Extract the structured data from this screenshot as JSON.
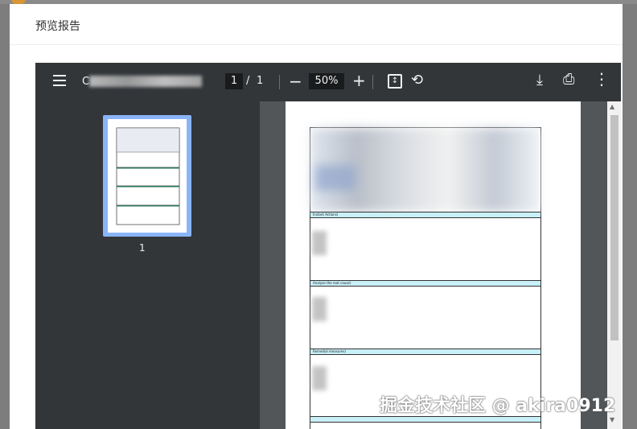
{
  "dialog": {
    "title": "预览报告"
  },
  "toolbar": {
    "filename_prefix": "C",
    "page_current": "1",
    "page_separator": "/",
    "page_total": "1",
    "zoom": "50%",
    "icons": [
      "menu-icon",
      "zoom-out-icon",
      "zoom-in-icon",
      "fit-page-icon",
      "rotate-icon",
      "download-icon",
      "print-icon",
      "more-icon"
    ]
  },
  "sidebar": {
    "thumbnail_number": "1"
  },
  "document": {
    "sections": [
      "Instant Actions)",
      "Analyse the root cause)",
      "Remedial measures)"
    ]
  },
  "watermark": {
    "text": "掘金技术社区 @ akira0912"
  },
  "colors": {
    "toolbar": "#323639",
    "viewer": "#525659",
    "thumb_border": "#8ab4f8",
    "section_fill": "#c8f0f8"
  }
}
